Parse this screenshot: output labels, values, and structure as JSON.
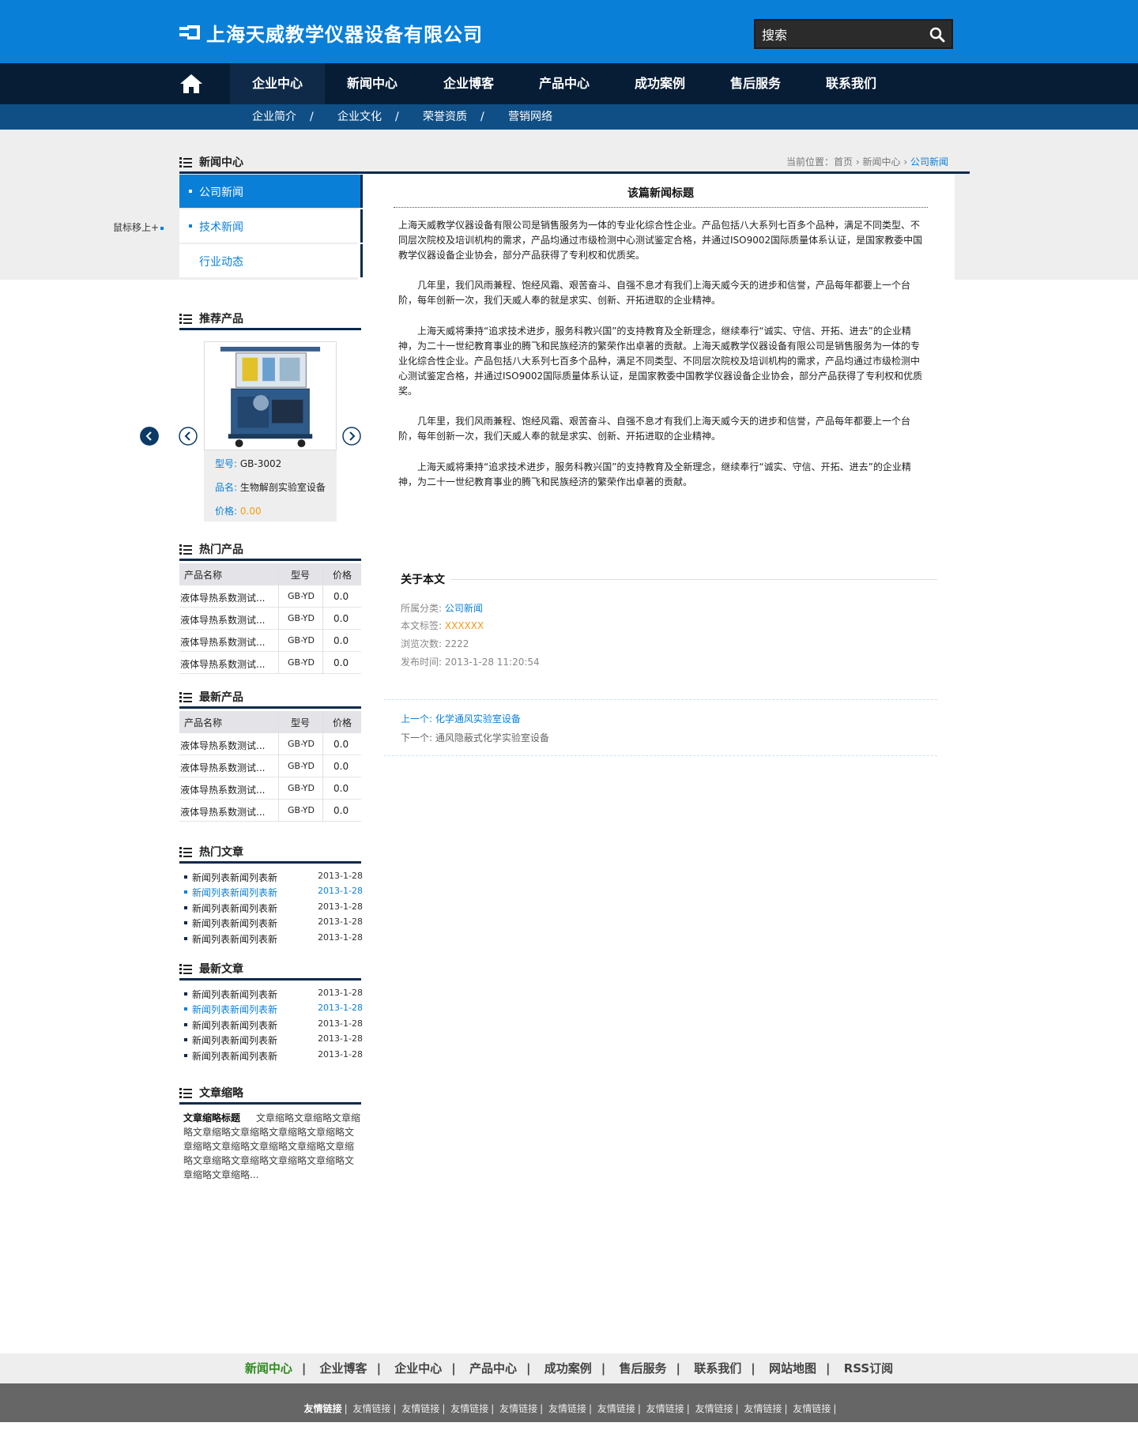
{
  "brand": {
    "name": "上海天威教学仪器设备有限公司"
  },
  "search": {
    "placeholder": "搜索"
  },
  "nav": {
    "items": [
      "企业中心",
      "新闻中心",
      "企业博客",
      "产品中心",
      "成功案例",
      "售后服务",
      "联系我们"
    ]
  },
  "subnav": {
    "items": [
      "企业简介",
      "企业文化",
      "荣誉资质",
      "营销网络"
    ],
    "separator": "/"
  },
  "mouse_hint": "鼠标移上+",
  "sidebar": {
    "news_title": "新闻中心",
    "menu": [
      "公司新闻",
      "技术新闻",
      "行业动态"
    ],
    "recommend_title": "推荐产品",
    "product": {
      "model_label": "型号:",
      "model": "GB-3002",
      "name_label": "品名:",
      "name": "生物解剖实验室设备",
      "price_label": "价格:",
      "price": "0.00"
    },
    "hot_products_title": "热门产品",
    "new_products_title": "最新产品",
    "table_headers": [
      "产品名称",
      "型号",
      "价格"
    ],
    "hot_products": [
      {
        "name": "液体导热系数测试...",
        "model": "GB-YD",
        "price": "0.0"
      },
      {
        "name": "液体导热系数测试...",
        "model": "GB-YD",
        "price": "0.0"
      },
      {
        "name": "液体导热系数测试...",
        "model": "GB-YD",
        "price": "0.0"
      },
      {
        "name": "液体导热系数测试...",
        "model": "GB-YD",
        "price": "0.0"
      }
    ],
    "new_products": [
      {
        "name": "液体导热系数测试...",
        "model": "GB-YD",
        "price": "0.0"
      },
      {
        "name": "液体导热系数测试...",
        "model": "GB-YD",
        "price": "0.0"
      },
      {
        "name": "液体导热系数测试...",
        "model": "GB-YD",
        "price": "0.0"
      },
      {
        "name": "液体导热系数测试...",
        "model": "GB-YD",
        "price": "0.0"
      }
    ],
    "hot_articles_title": "热门文章",
    "hot_articles": [
      {
        "title": "新闻列表新闻列表新",
        "date": "2013-1-28"
      },
      {
        "title": "新闻列表新闻列表新",
        "date": "2013-1-28"
      },
      {
        "title": "新闻列表新闻列表新",
        "date": "2013-1-28"
      },
      {
        "title": "新闻列表新闻列表新",
        "date": "2013-1-28"
      },
      {
        "title": "新闻列表新闻列表新",
        "date": "2013-1-28"
      }
    ],
    "new_articles_title": "最新文章",
    "new_articles": [
      {
        "title": "新闻列表新闻列表新",
        "date": "2013-1-28"
      },
      {
        "title": "新闻列表新闻列表新",
        "date": "2013-1-28"
      },
      {
        "title": "新闻列表新闻列表新",
        "date": "2013-1-28"
      },
      {
        "title": "新闻列表新闻列表新",
        "date": "2013-1-28"
      },
      {
        "title": "新闻列表新闻列表新",
        "date": "2013-1-28"
      }
    ],
    "summary_section_title": "文章缩略",
    "summary_title": "文章缩略标题",
    "summary_text": "文章缩略文章缩略文章缩略文章缩略文章缩略文章缩略文章缩略文章缩略文章缩略文章缩略文章缩略文章缩略文章缩略文章缩略文章缩略文章缩略文章缩略文章缩略..."
  },
  "breadcrumb": {
    "label": "当前位置：",
    "items": [
      "首页",
      "新闻中心",
      "公司新闻"
    ]
  },
  "article": {
    "title": "该篇新闻标题",
    "paragraphs": [
      "上海天威教学仪器设备有限公司是销售服务为一体的专业化综合性企业。产品包括八大系列七百多个品种，满足不同类型、不同层次院校及培训机构的需求，产品均通过市级检测中心测试鉴定合格，并通过ISO9002国际质量体系认证，是国家教委中国教学仪器设备企业协会，部分产品获得了专利权和优质奖。",
      "　　几年里，我们风雨兼程、饱经风霜、艰苦奋斗、自强不息才有我们上海天威今天的进步和信誉，产品每年都要上一个台阶，每年创新一次，我们天威人奉的就是求实、创新、开拓进取的企业精神。",
      "　　上海天威将秉持“追求技术进步，服务科教兴国”的支持教育及全新理念，继续奉行“诚实、守信、开拓、进去”的企业精神，为二十一世纪教育事业的腾飞和民族经济的繁荣作出卓著的贡献。上海天威教学仪器设备有限公司是销售服务为一体的专业化综合性企业。产品包括八大系列七百多个品种，满足不同类型、不同层次院校及培训机构的需求，产品均通过市级检测中心测试鉴定合格，并通过ISO9002国际质量体系认证，是国家教委中国教学仪器设备企业协会，部分产品获得了专利权和优质奖。",
      "　　几年里，我们风雨兼程、饱经风霜、艰苦奋斗、自强不息才有我们上海天威今天的进步和信誉，产品每年都要上一个台阶，每年创新一次，我们天威人奉的就是求实、创新、开拓进取的企业精神。",
      "　　上海天威将秉持“追求技术进步，服务科教兴国”的支持教育及全新理念，继续奉行“诚实、守信、开拓、进去”的企业精神，为二十一世纪教育事业的腾飞和民族经济的繁荣作出卓著的贡献。"
    ]
  },
  "about": {
    "title": "关于本文",
    "category_label": "所属分类:",
    "category": "公司新闻",
    "tags_label": "本文标签:",
    "tags": "XXXXXX",
    "views_label": "浏览次数:",
    "views": "2222",
    "published_label": "发布时间:",
    "published": "2013-1-28 11:20:54"
  },
  "pager": {
    "prev": "上一个: 化学通风实验室设备",
    "next": "下一个: 通风隐蔽式化学实验室设备"
  },
  "footer_nav": [
    "新闻中心",
    "企业博客",
    "企业中心",
    "产品中心",
    "成功案例",
    "售后服务",
    "联系我们",
    "网站地图",
    "RSS订阅"
  ],
  "friend_links": [
    "友情链接",
    "友情链接",
    "友情链接",
    "友情链接",
    "友情链接",
    "友情链接",
    "友情链接",
    "友情链接",
    "友情链接",
    "友情链接",
    "友情链接"
  ],
  "colors": {
    "brand_blue": "#0a7fd8",
    "nav_dark": "#061d35",
    "subnav": "#0f4f86",
    "price_orange": "#f39b1a",
    "footer_green": "#2e8b1f"
  }
}
